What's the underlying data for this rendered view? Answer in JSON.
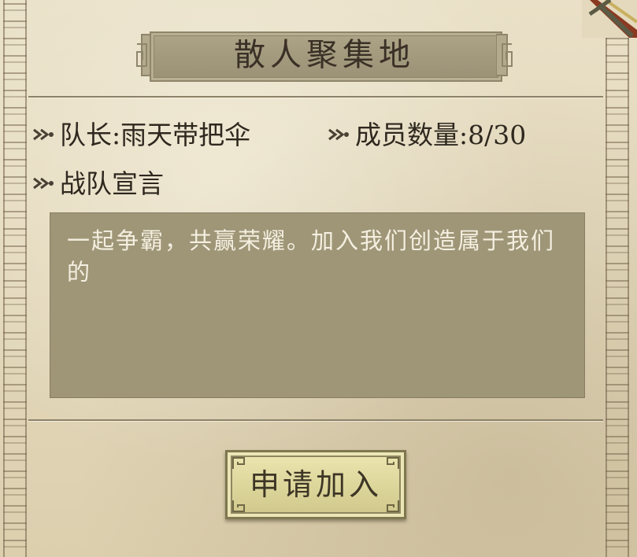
{
  "title": "散人聚集地",
  "leader": {
    "label": "队长:雨天带把伞"
  },
  "members": {
    "label": "成员数量:8/30"
  },
  "declaration": {
    "heading": "战队宣言",
    "text": "一起争霸，共赢荣耀。加入我们创造属于我们的"
  },
  "join_button": {
    "label": "申请加入"
  },
  "icons": {
    "bullet": "double-chevron-icon",
    "close": "close-icon"
  },
  "colors": {
    "parchment": "#e4d9bd",
    "plaque": "#a39a7e",
    "declaration_box": "#9f9678",
    "button": "#dcd59a",
    "text": "#2f281f"
  }
}
